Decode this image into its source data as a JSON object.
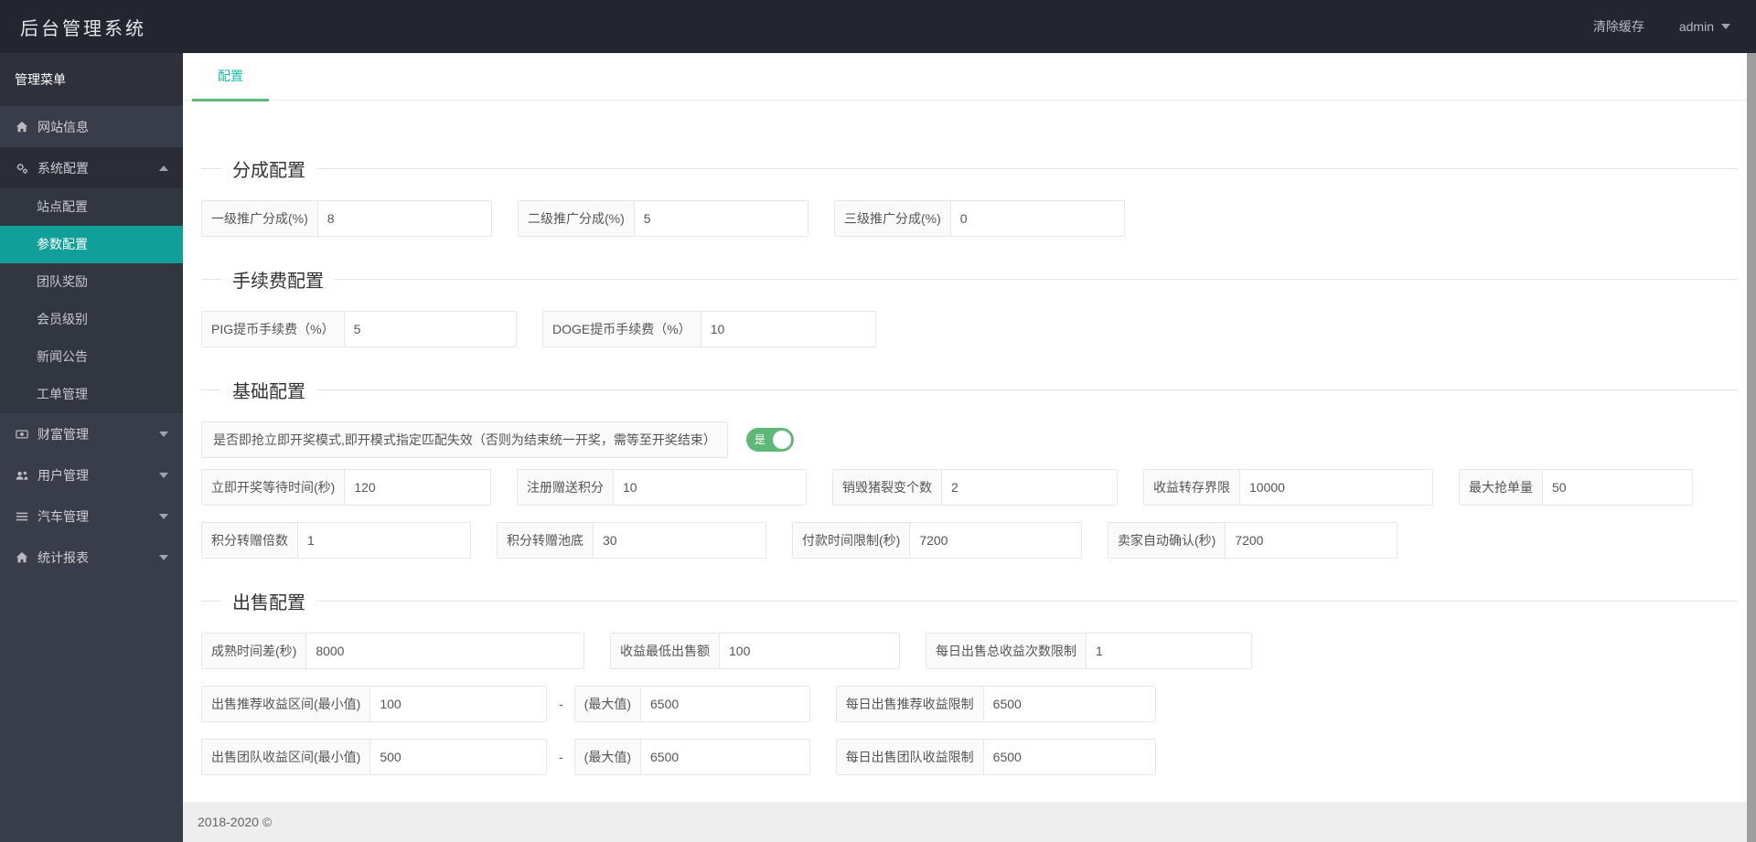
{
  "header": {
    "title": "后台管理系统",
    "clear_cache": "清除缓存",
    "user": "admin"
  },
  "sidebar": {
    "menu_title": "管理菜单",
    "items": [
      {
        "label": "网站信息",
        "icon": "home-icon"
      },
      {
        "label": "系统配置",
        "icon": "cogs-icon",
        "expanded": true
      },
      {
        "label": "财富管理",
        "icon": "money-icon"
      },
      {
        "label": "用户管理",
        "icon": "users-icon"
      },
      {
        "label": "汽车管理",
        "icon": "list-icon"
      },
      {
        "label": "统计报表",
        "icon": "home-icon"
      }
    ],
    "system_children": [
      "站点配置",
      "参数配置",
      "团队奖励",
      "会员级别",
      "新闻公告",
      "工单管理"
    ],
    "active_item": "参数配置"
  },
  "tab": {
    "label": "配置"
  },
  "sections": [
    {
      "title": "分成配置",
      "fields": [
        {
          "label": "一级推广分成(%)",
          "value": "8"
        },
        {
          "label": "二级推广分成(%)",
          "value": "5"
        },
        {
          "label": "三级推广分成(%)",
          "value": "0"
        }
      ]
    },
    {
      "title": "手续费配置",
      "fields": [
        {
          "label": "PIG提币手续费（%）",
          "value": "5"
        },
        {
          "label": "DOGE提币手续费（%）",
          "value": "10"
        }
      ]
    },
    {
      "title": "基础配置",
      "toggle": {
        "label": "是否即抢立即开奖模式,即开模式指定匹配失效（否则为结束统一开奖，需等至开奖结束）",
        "state": "是"
      },
      "row1": [
        {
          "label": "立即开奖等待时间(秒)",
          "value": "120"
        },
        {
          "label": "注册赠送积分",
          "value": "10"
        },
        {
          "label": "销毁猪裂变个数",
          "value": "2"
        },
        {
          "label": "收益转存界限",
          "value": "10000"
        },
        {
          "label": "最大抢单量",
          "value": "50"
        }
      ],
      "row2": [
        {
          "label": "积分转赠倍数",
          "value": "1"
        },
        {
          "label": "积分转赠池底",
          "value": "30"
        },
        {
          "label": "付款时间限制(秒)",
          "value": "7200"
        },
        {
          "label": "卖家自动确认(秒)",
          "value": "7200"
        }
      ]
    },
    {
      "title": "出售配置",
      "row1": [
        {
          "label": "成熟时间差(秒)",
          "value": "8000"
        },
        {
          "label": "收益最低出售额",
          "value": "100"
        },
        {
          "label": "每日出售总收益次数限制",
          "value": "1"
        }
      ],
      "row2_separator": "-",
      "row2": [
        {
          "label": "出售推荐收益区间(最小值)",
          "value": "100"
        },
        {
          "label": "(最大值)",
          "value": "6500"
        },
        {
          "label": "每日出售推荐收益限制",
          "value": "6500"
        }
      ],
      "row3_separator": "-",
      "row3": [
        {
          "label": "出售团队收益区间(最小值)",
          "value": "500"
        },
        {
          "label": "(最大值)",
          "value": "6500"
        },
        {
          "label": "每日出售团队收益限制",
          "value": "6500"
        }
      ]
    }
  ],
  "footer": {
    "copyright": "2018-2020 ©"
  },
  "colors": {
    "header_bg": "#23262E",
    "sidebar_bg": "#393D49",
    "sidebar_active": "#10A099",
    "tab_text": "#16baaa",
    "accent_green": "#5FB878",
    "footer_bg": "#EEEEEE"
  }
}
